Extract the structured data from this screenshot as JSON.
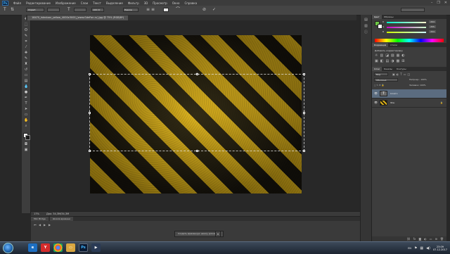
{
  "app": {
    "logo": "Ps"
  },
  "menu": [
    "Файл",
    "Редактирование",
    "Изображение",
    "Слои",
    "Текст",
    "Выделение",
    "Фильтр",
    "3D",
    "Просмотр",
    "Окно",
    "Справка"
  ],
  "window_controls": {
    "minimize": "–",
    "restore": "❐",
    "close": "✕"
  },
  "options_bar": {
    "font_family": "Impact",
    "font_size": "100 пт",
    "antialias": "Резкое"
  },
  "document": {
    "tab_title": "18470_hdeclaar_yellow_4000x3000_[www.GdeFon.ru].jpg @ 75% (RGB/8*)"
  },
  "canvas": {
    "stripe_colors": [
      "#17140d",
      "#d8ae1a"
    ]
  },
  "status": {
    "zoom": "17%",
    "doc_info": "Док: 34,3M/34,3M"
  },
  "timeline": {
    "tabs": [
      "Mini Bridge",
      "Шкала времени"
    ],
    "create_button": "Создать временную шкалу для видео"
  },
  "panels": {
    "color_tabs": [
      "Цвет",
      "Образцы"
    ],
    "color": {
      "fg": "#6cc644",
      "bg": "#ffffff",
      "channels": [
        {
          "label": "R",
          "value": "204"
        },
        {
          "label": "G",
          "value": "255"
        },
        {
          "label": "B",
          "value": "204"
        }
      ]
    },
    "adjust_tabs": [
      "Коррекция",
      "Стили"
    ],
    "adjust_title": "Добавить корректировку",
    "layers_tabs": [
      "Слои",
      "Каналы",
      "Контуры"
    ],
    "layer_filter": "Вид",
    "blend_mode": "Обычные",
    "opacity_label": "Непрозр.: 100%",
    "fill_label": "Заливка: 100%",
    "layers": [
      {
        "name": "Слой 1",
        "kind": "T",
        "selected": true
      },
      {
        "name": "Фон",
        "kind": "bg",
        "selected": false,
        "locked": true
      }
    ]
  },
  "taskbar": {
    "apps": [
      "ie",
      "yandex",
      "chrome",
      "explorer",
      "photoshop",
      "media"
    ],
    "lang": "EN",
    "time": "23:09",
    "date": "07.12.2017"
  }
}
